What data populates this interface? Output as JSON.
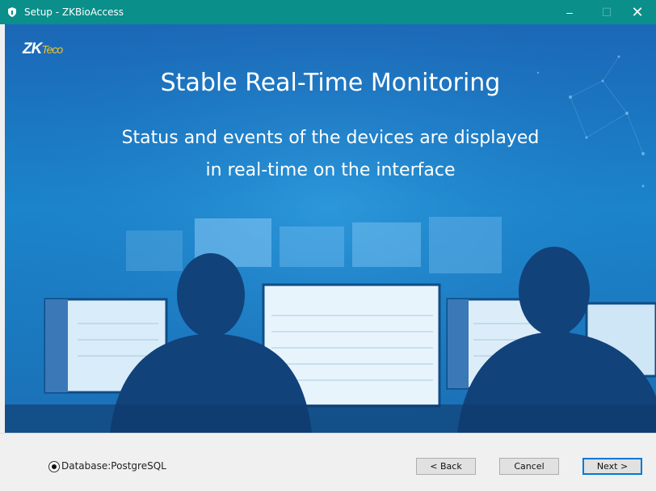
{
  "window": {
    "title": "Setup - ZKBioAccess",
    "minimize_glyph": "‒",
    "maximize_glyph": "☐",
    "close_glyph": "✕",
    "accent_color": "#0a8f8a"
  },
  "banner": {
    "logo_main": "ZK",
    "logo_sub": "Teco",
    "headline": "Stable Real-Time Monitoring",
    "subline_1": "Status and events of the devices are displayed",
    "subline_2": "in real-time on the interface"
  },
  "footer": {
    "database_label": "Database:PostgreSQL",
    "database_selected": true,
    "back_label": "< Back",
    "cancel_label": "Cancel",
    "next_label": "Next >"
  }
}
